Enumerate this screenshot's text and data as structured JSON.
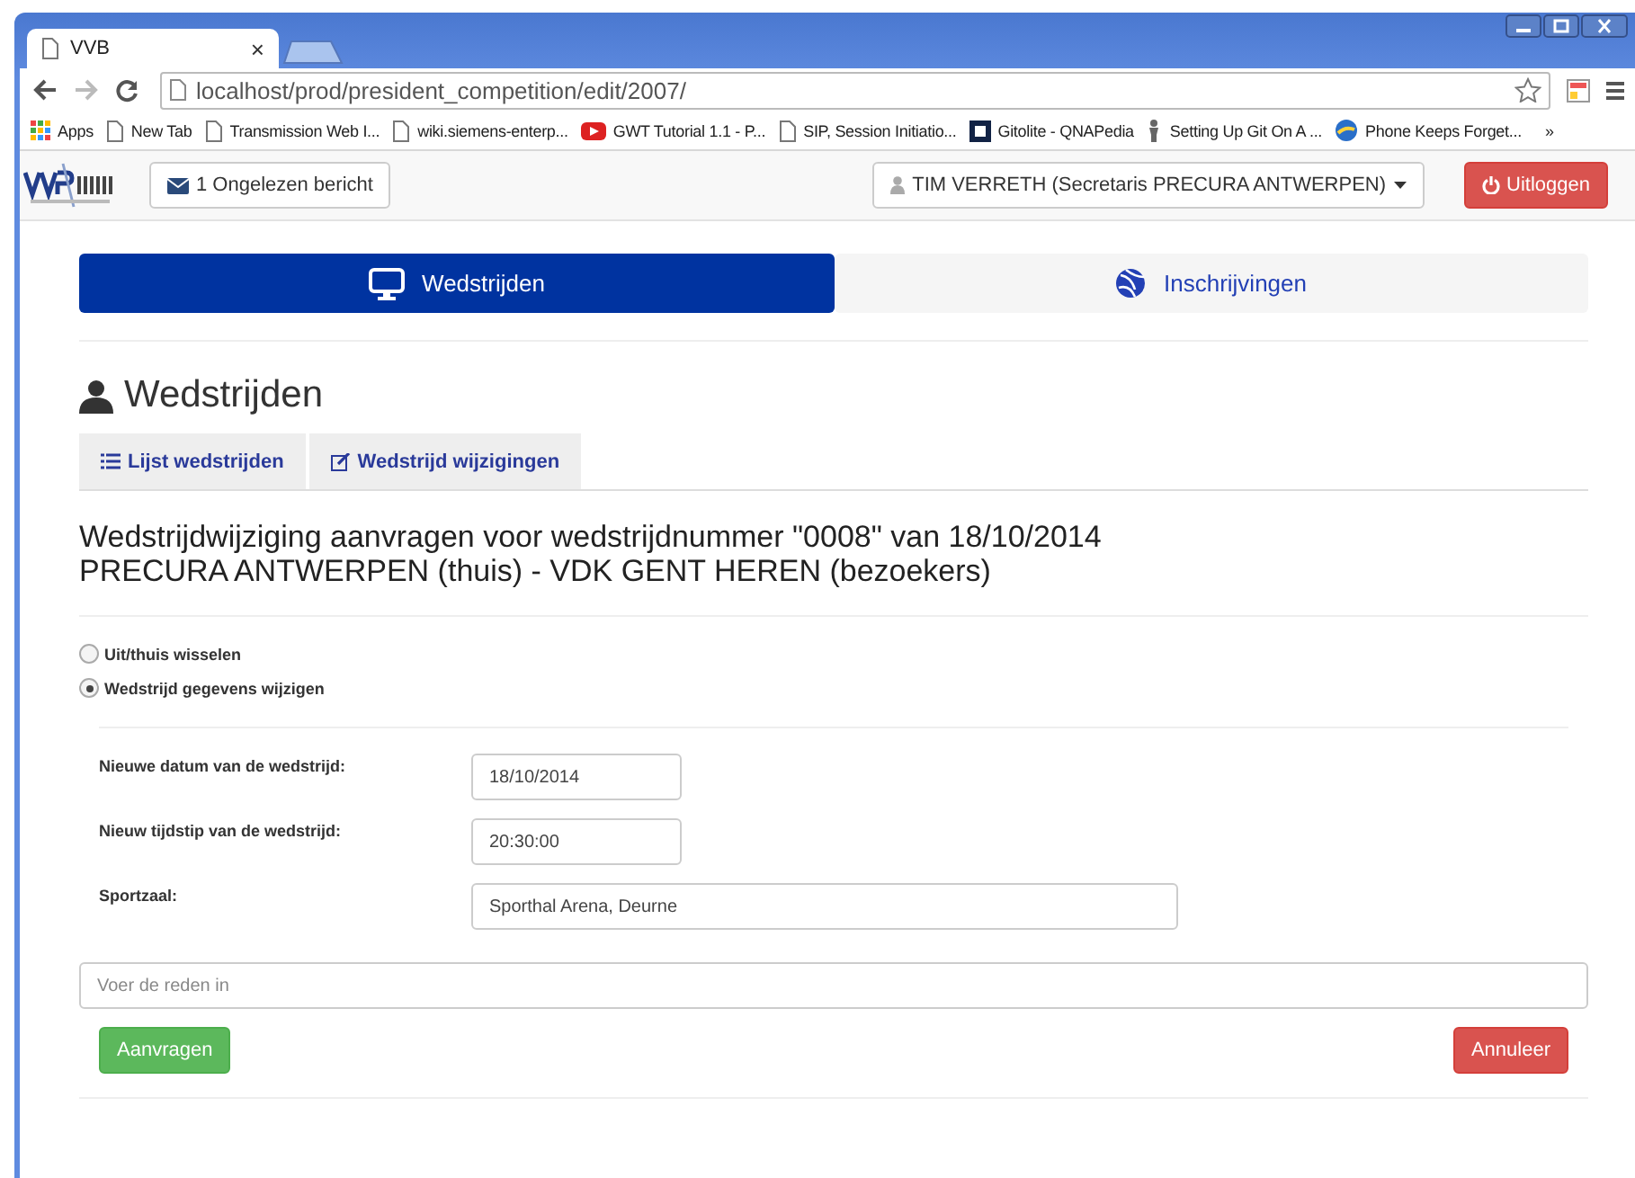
{
  "browser": {
    "tab_title": "VVB",
    "close_glyph": "×",
    "url": "localhost/prod/president_competition/edit/2007/",
    "bookmarks": [
      {
        "kind": "apps",
        "label": "Apps"
      },
      {
        "kind": "page",
        "label": "New Tab"
      },
      {
        "kind": "page",
        "label": "Transmission Web I..."
      },
      {
        "kind": "page",
        "label": "wiki.siemens-enterp..."
      },
      {
        "kind": "video",
        "label": "GWT Tutorial 1.1 - P..."
      },
      {
        "kind": "page",
        "label": "SIP, Session Initiatio..."
      },
      {
        "kind": "square",
        "label": "Gitolite - QNAPedia"
      },
      {
        "kind": "figure",
        "label": "Setting Up Git On A ..."
      },
      {
        "kind": "globe",
        "label": "Phone Keeps Forget..."
      }
    ],
    "more_glyph": "»"
  },
  "navbar": {
    "messages": "1 Ongelezen bericht",
    "user": "TIM VERRETH (Secretaris PRECURA ANTWERPEN)",
    "logout": "Uitloggen"
  },
  "main_tabs": [
    {
      "kind": "monitor",
      "label": "Wedstrijden",
      "selected": true
    },
    {
      "kind": "ball",
      "label": "Inschrijvingen",
      "selected": false
    }
  ],
  "heading": "Wedstrijden",
  "sub_tabs": [
    {
      "kind": "list",
      "label": "Lijst wedstrijden"
    },
    {
      "kind": "edit",
      "label": "Wedstrijd wijzigingen"
    }
  ],
  "title_lines": [
    "Wedstrijdwijziging aanvragen voor wedstrijdnummer \"0008\" van 18/10/2014",
    "PRECURA ANTWERPEN (thuis) - VDK GENT HEREN (bezoekers)"
  ],
  "options": [
    {
      "label": "Uit/thuis wisselen",
      "selected": false
    },
    {
      "label": "Wedstrijd gegevens wijzigen",
      "selected": true
    }
  ],
  "fields": [
    {
      "label": "Nieuwe datum van de wedstrijd:",
      "value": "18/10/2014",
      "kind": "short"
    },
    {
      "label": "Nieuw tijdstip van de wedstrijd:",
      "value": "20:30:00",
      "kind": "short"
    },
    {
      "label": "Sportzaal:",
      "value": "Sporthal Arena, Deurne",
      "kind": "long"
    }
  ],
  "reason": {
    "placeholder": "Voer de reden in"
  },
  "buttons": {
    "submit": "Aanvragen",
    "cancel": "Annuleer"
  }
}
